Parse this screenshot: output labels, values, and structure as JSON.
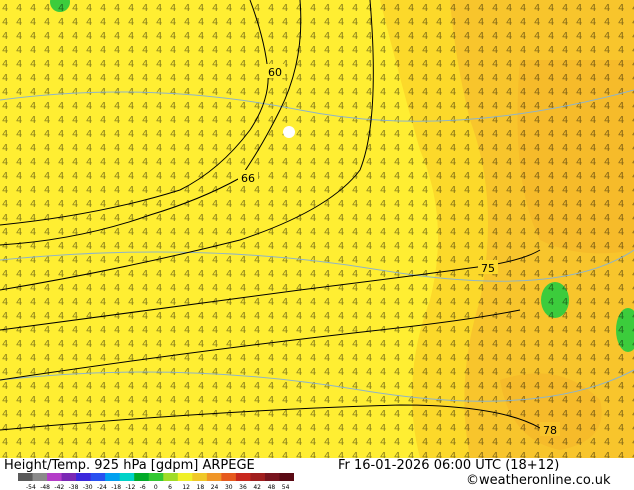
{
  "title": "Height/Temp. 925 hPa [gdpm] ARPEGE",
  "valid_time": "Fr 16-01-2026 06:00 UTC (18+12)",
  "credit": "©weatheronline.co.uk",
  "contour_labels": [
    "60",
    "66",
    "75",
    "78"
  ],
  "colorbar": {
    "ticks": [
      "-54",
      "-48",
      "-42",
      "-38",
      "-30",
      "-24",
      "-18",
      "-12",
      "-6",
      "0",
      "6",
      "12",
      "18",
      "24",
      "30",
      "36",
      "42",
      "48",
      "54"
    ],
    "colors": [
      "#5a5a5a",
      "#8a8a8a",
      "#b43cc8",
      "#7a28b4",
      "#3c28dc",
      "#2850f0",
      "#00a0f0",
      "#00d2c8",
      "#00aa28",
      "#32c832",
      "#a0dc28",
      "#f0f028",
      "#f0c828",
      "#f09628",
      "#e65a1e",
      "#c8281e",
      "#a01e1e",
      "#78141e",
      "#5a0a14"
    ]
  },
  "palette": {
    "t2": "#ffee32",
    "t3": "#fde52c",
    "t4": "#fcd92a",
    "t5": "#f8c52c",
    "green": "#3ccc3c",
    "isohypse": "#000000",
    "isotherm": "#8fb4c8"
  }
}
